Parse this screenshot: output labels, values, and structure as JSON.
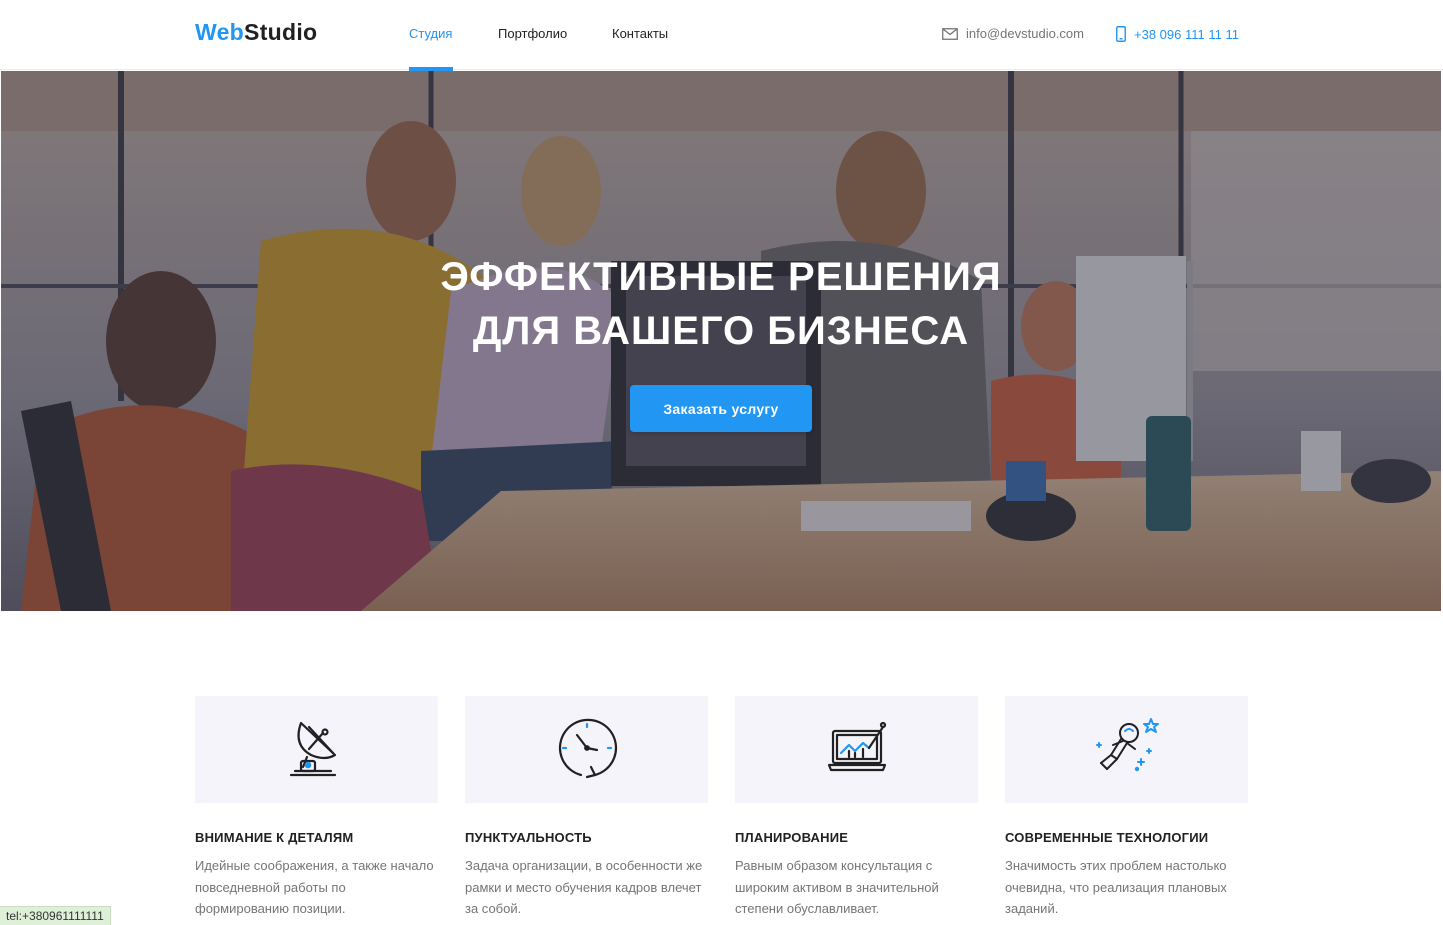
{
  "header": {
    "logo_web": "Web",
    "logo_studio": "Studio",
    "nav": [
      {
        "label": "Студия",
        "active": true
      },
      {
        "label": "Портфолио",
        "active": false
      },
      {
        "label": "Контакты",
        "active": false
      }
    ],
    "email": {
      "icon": "mail-icon",
      "text": "info@devstudio.com"
    },
    "phone": {
      "icon": "phone-icon",
      "text": "+38 096 111 11 11"
    }
  },
  "hero": {
    "title_line1": "Эффективные решения",
    "title_line2": "для вашего бизнеса",
    "button": "Заказать услугу"
  },
  "features": [
    {
      "icon": "satellite-dish-icon",
      "title": "Внимание к деталям",
      "text": "Идейные соображения, а также начало повседневной работы по формированию позиции."
    },
    {
      "icon": "clock-icon",
      "title": "Пунктуальность",
      "text": "Задача организации, в особенности же рамки и место обучения кадров влечет за собой."
    },
    {
      "icon": "laptop-chart-icon",
      "title": "Планирование",
      "text": "Равным образом консультация с широким активом в значительной степени обуславливает."
    },
    {
      "icon": "astronaut-icon",
      "title": "Современные технологии",
      "text": "Значимость этих проблем настолько очевидна, что реализация плановых заданий."
    }
  ],
  "statusbar": {
    "text": "tel:+380961111111"
  },
  "colors": {
    "accent": "#2196f3",
    "text": "#212121",
    "muted": "#757575",
    "feature_bg": "#f5f4fa"
  }
}
